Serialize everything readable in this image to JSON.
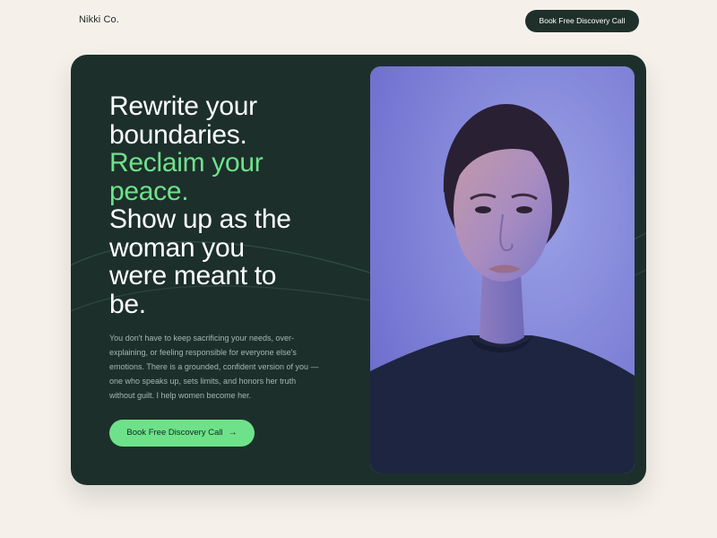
{
  "nav": {
    "brand": "Nikki Co.",
    "cta_label": "Book Free Discovery Call"
  },
  "hero": {
    "headline": {
      "line1": "Rewrite your",
      "line2": "boundaries.",
      "line3": "Reclaim your",
      "line4": "peace.",
      "line5": "Show up as the",
      "line6": "woman you",
      "line7": "were meant to",
      "line8": "be."
    },
    "body": "You don't have to keep sacrificing your needs, over-explaining, or feeling responsible for everyone else's emotions. There is a grounded, confident version of you — one who speaks up, sets limits, and honors her truth without guilt. I help women become her.",
    "cta_label": "Book Free Discovery Call",
    "cta_icon": "arrow-right-icon",
    "photo": "portrait-photo"
  },
  "colors": {
    "page_bg": "#f5f1ea",
    "hero_bg": "#1d2f2b",
    "accent": "#6ee28a",
    "nav_button": "#1f302b"
  }
}
